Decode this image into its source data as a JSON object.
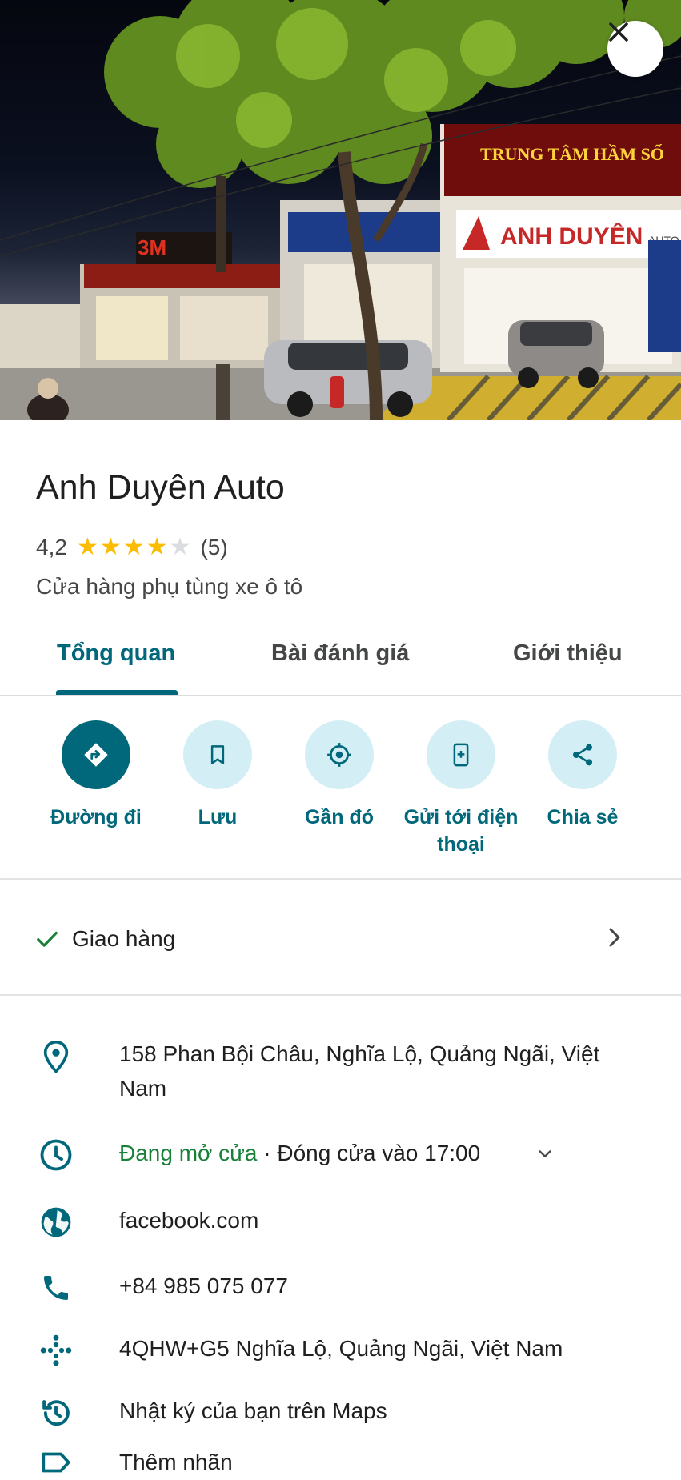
{
  "hero": {
    "close_icon": "close-icon",
    "photo_description": "",
    "sign_brand": "ANH DUYÊN",
    "sign_auto": "AUTO",
    "sign_center": "TRUNG TÂM HẦM SỐ",
    "sign_3m": "3M"
  },
  "place": {
    "name": "Anh Duyên Auto",
    "rating": "4,2",
    "rating_value": 4.2,
    "review_count": "(5)",
    "category": "Cửa hàng phụ tùng xe ô tô"
  },
  "tabs": [
    {
      "label": "Tổng quan",
      "active": true
    },
    {
      "label": "Bài đánh giá",
      "active": false
    },
    {
      "label": "Giới thiệu",
      "active": false
    }
  ],
  "actions": [
    {
      "label": "Đường đi",
      "icon": "directions-icon"
    },
    {
      "label": "Lưu",
      "icon": "bookmark-icon"
    },
    {
      "label": "Gần đó",
      "icon": "nearby-icon"
    },
    {
      "label": "Gửi tới điện thoại",
      "icon": "send-to-phone-icon"
    },
    {
      "label": "Chia sẻ",
      "icon": "share-icon"
    }
  ],
  "delivery": {
    "label": "Giao hàng",
    "icon": "check-icon"
  },
  "info": {
    "address": "158 Phan Bội Châu, Nghĩa Lộ, Quảng Ngãi, Việt Nam",
    "hours_status": "Đang mở cửa",
    "hours_detail": " · Đóng cửa vào 17:00",
    "website": "facebook.com",
    "phone": "+84 985 075 077",
    "plus_code": "4QHW+G5 Nghĩa Lộ, Quảng Ngãi, Việt Nam",
    "history": "Nhật ký của bạn trên Maps",
    "label": "Thêm nhãn"
  },
  "colors": {
    "accent": "#00687a",
    "accent_light": "#d3eff5",
    "star": "#fbbc04",
    "open_green": "#188038"
  }
}
